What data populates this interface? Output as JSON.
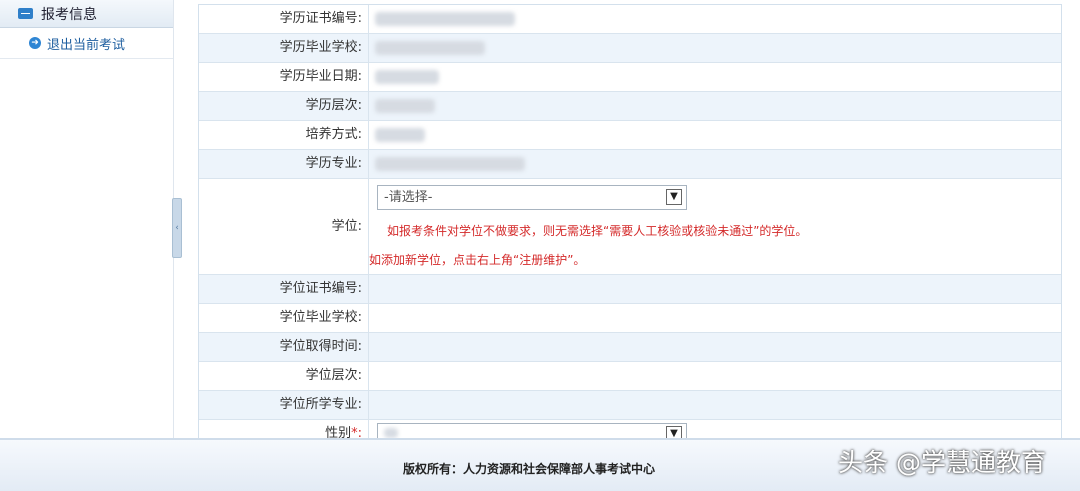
{
  "sidebar": {
    "header": "报考信息",
    "items": [
      {
        "label": "退出当前考试"
      }
    ]
  },
  "form": {
    "edu_cert_no": "学历证书编号:",
    "edu_school": "学历毕业学校:",
    "edu_grad_date": "学历毕业日期:",
    "edu_level": "学历层次:",
    "training_mode": "培养方式:",
    "edu_major": "学历专业:",
    "degree": "学位:",
    "degree_select_value": "-请选择-",
    "degree_hint_1": "如报考条件对学位不做要求，则无需选择“需要人工核验或核验未通过”的学位。",
    "degree_hint_2": "如添加新学位，点击右上角“注册维护”。",
    "degree_cert_no": "学位证书编号:",
    "degree_school": "学位毕业学校:",
    "degree_date": "学位取得时间:",
    "degree_level": "学位层次:",
    "degree_major": "学位所学专业:",
    "gender": "性别",
    "gender_req": "*:"
  },
  "footer": {
    "copyright": "版权所有：人力资源和社会保障部人事考试中心"
  },
  "watermark": "头条 @学慧通教育"
}
